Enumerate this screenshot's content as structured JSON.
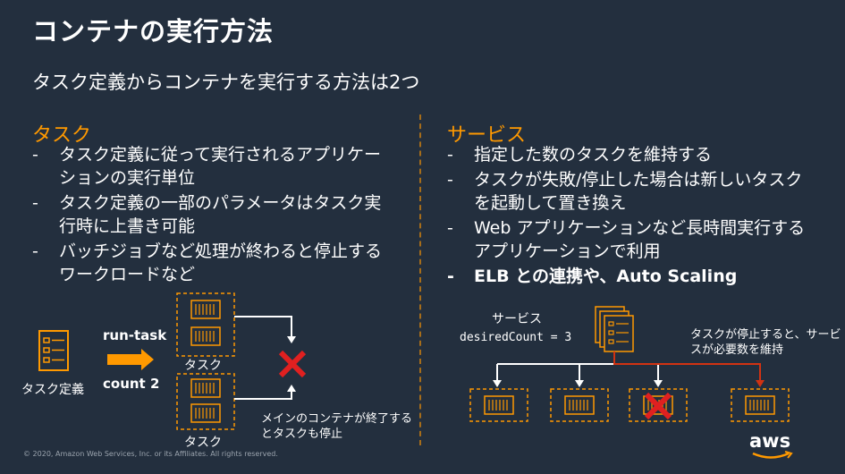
{
  "slide": {
    "title": "コンテナの実行方法",
    "subtitle": "タスク定義からコンテナを実行する方法は2つ"
  },
  "left": {
    "heading": "タスク",
    "bullets": [
      "タスク定義に従って実行されるアプリケーションの実行単位",
      "タスク定義の一部のパラメータはタスク実行時に上書き可能",
      "バッチジョブなど処理が終わると停止するワークロードなど"
    ]
  },
  "right": {
    "heading": "サービス",
    "bullets": [
      "指定した数のタスクを維持する",
      "タスクが失敗/停止した場合は新しいタスクを起動して置き換え",
      "Web アプリケーションなど長時間実行するアプリケーションで利用",
      "ELB との連携や、Auto Scaling"
    ]
  },
  "left_diagram": {
    "task_def_label": "タスク定義",
    "command": "run-task",
    "count": "count 2",
    "task_label_1": "タスク",
    "task_label_2": "タスク",
    "note": "メインのコンテナが終了するとタスクも停止"
  },
  "right_diagram": {
    "service_label": "サービス",
    "desired": "desiredCount = 3",
    "note": "タスクが停止すると、サービスが必要数を維持"
  },
  "footer": "© 2020, Amazon Web Services, Inc. or its Affiliates. All rights reserved.",
  "logo": "aws",
  "colors": {
    "accent": "#ff9900",
    "background": "#232f3e",
    "error": "#e02020",
    "arrow_red": "#d13212"
  }
}
